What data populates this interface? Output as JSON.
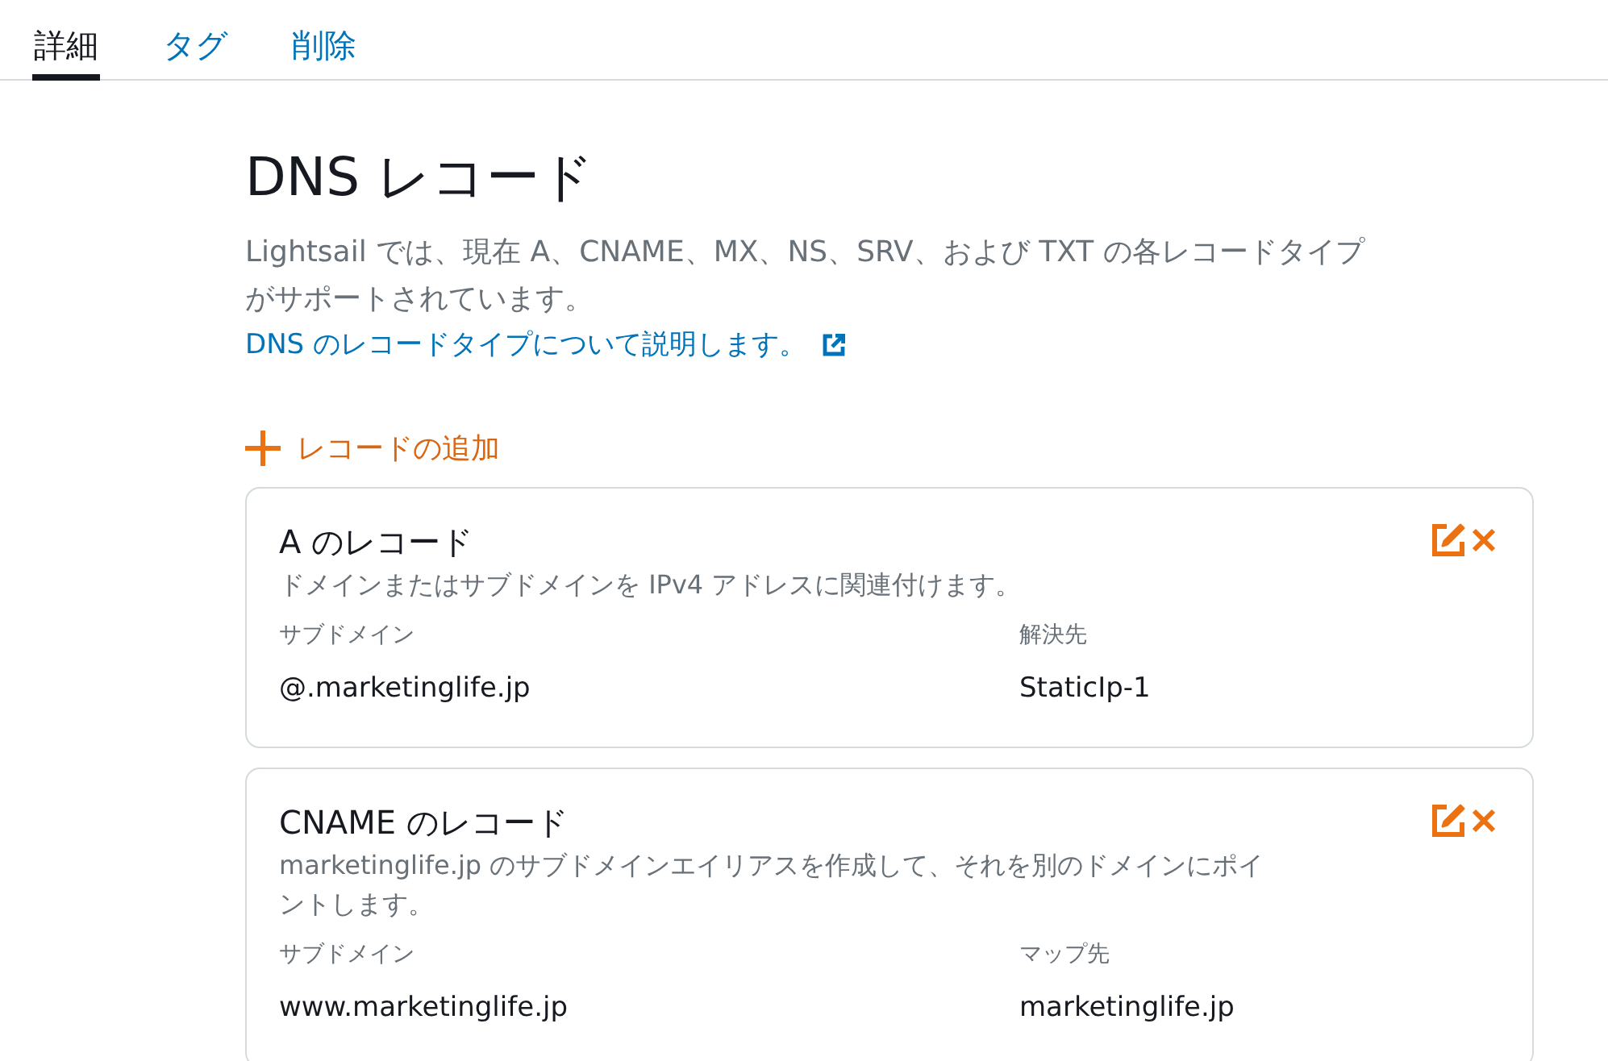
{
  "tabs": [
    {
      "label": "詳細",
      "selected": true
    },
    {
      "label": "タグ",
      "selected": false
    },
    {
      "label": "削除",
      "selected": false
    }
  ],
  "section": {
    "title": "DNS レコード",
    "description": "Lightsail では、現在 A、CNAME、MX、NS、SRV、および TXT の各レコードタイプがサポートされています。",
    "link": "DNS のレコードタイプについて説明します。"
  },
  "add_record_button": {
    "label": "レコードの追加"
  },
  "records": [
    {
      "title": "A のレコード",
      "description": "ドメインまたはサブドメインを IPv4 アドレスに関連付けます。",
      "fields": [
        {
          "label": "サブドメイン",
          "value": "@.marketinglife.jp"
        },
        {
          "label": "解決先",
          "value": "StaticIp-1"
        }
      ]
    },
    {
      "title": "CNAME のレコード",
      "description": "marketinglife.jp のサブドメインエイリアスを作成して、それを別のドメインにポイントします。",
      "fields": [
        {
          "label": "サブドメイン",
          "value": "www.marketinglife.jp"
        },
        {
          "label": "マップ先",
          "value": "marketinglife.jp"
        }
      ]
    }
  ]
}
